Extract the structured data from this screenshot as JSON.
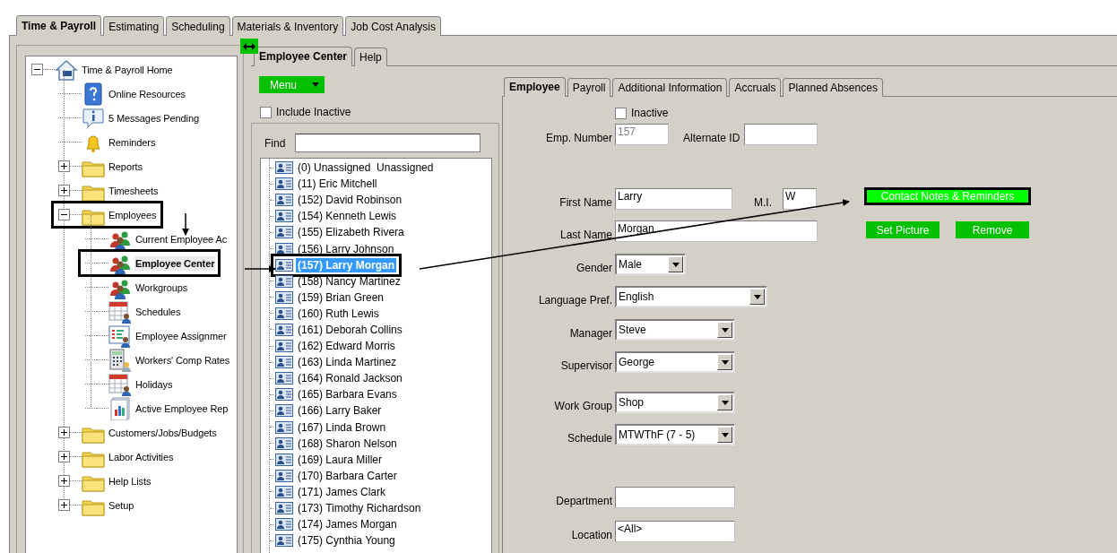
{
  "app_tabs": [
    {
      "label": "Time & Payroll",
      "selected": true
    },
    {
      "label": "Estimating",
      "selected": false
    },
    {
      "label": "Scheduling",
      "selected": false
    },
    {
      "label": "Materials & Inventory",
      "selected": false
    },
    {
      "label": "Job Cost Analysis",
      "selected": false
    }
  ],
  "nav_tree": {
    "label": "Time & Payroll Home",
    "kind": "home",
    "expanded": true,
    "selected": false,
    "highlighted": false,
    "children": [
      {
        "label": "Online Resources",
        "kind": "help",
        "selected": false,
        "highlighted": false
      },
      {
        "label": "5 Messages Pending",
        "kind": "info",
        "selected": false,
        "highlighted": false
      },
      {
        "label": "Reminders",
        "kind": "bell",
        "selected": false,
        "highlighted": false
      },
      {
        "label": "Reports",
        "kind": "folder",
        "expanded": false,
        "selected": false,
        "highlighted": false
      },
      {
        "label": "Timesheets",
        "kind": "folder",
        "expanded": false,
        "selected": false,
        "highlighted": false
      },
      {
        "label": "Employees",
        "kind": "folder",
        "expanded": true,
        "selected": false,
        "highlighted": true,
        "children": [
          {
            "label": "Current Employee Ac",
            "kind": "people",
            "selected": false,
            "highlighted": false
          },
          {
            "label": "Employee Center",
            "kind": "people",
            "selected": true,
            "highlighted": true
          },
          {
            "label": "Workgroups",
            "kind": "people",
            "selected": false,
            "highlighted": false
          },
          {
            "label": "Schedules",
            "kind": "calendar",
            "selected": false,
            "highlighted": false
          },
          {
            "label": "Employee Assignmer",
            "kind": "assignment",
            "selected": false,
            "highlighted": false
          },
          {
            "label": "Workers' Comp Rates",
            "kind": "calculator",
            "selected": false,
            "highlighted": false
          },
          {
            "label": "Holidays",
            "kind": "calendar",
            "selected": false,
            "highlighted": false
          },
          {
            "label": "Active Employee Rep",
            "kind": "report",
            "selected": false,
            "highlighted": false
          }
        ]
      },
      {
        "label": "Customers/Jobs/Budgets",
        "kind": "folder",
        "expanded": false,
        "selected": false,
        "highlighted": false
      },
      {
        "label": "Labor Activities",
        "kind": "folder",
        "expanded": false,
        "selected": false,
        "highlighted": false
      },
      {
        "label": "Help Lists",
        "kind": "folder",
        "expanded": false,
        "selected": false,
        "highlighted": false
      },
      {
        "label": "Setup",
        "kind": "folder",
        "expanded": false,
        "selected": false,
        "highlighted": false
      }
    ]
  },
  "center_tabs": [
    {
      "label": "Employee Center",
      "selected": true
    },
    {
      "label": "Help",
      "selected": false
    }
  ],
  "menu_button": {
    "label": "Menu"
  },
  "include_inactive": {
    "label": "Include Inactive",
    "checked": false
  },
  "find": {
    "label": "Find"
  },
  "employees": [
    {
      "label": "(0) Unassigned  Unassigned",
      "selected": false,
      "highlighted": false
    },
    {
      "label": "(11) Eric Mitchell",
      "selected": false,
      "highlighted": false
    },
    {
      "label": "(152) David Robinson",
      "selected": false,
      "highlighted": false
    },
    {
      "label": "(154) Kenneth Lewis",
      "selected": false,
      "highlighted": false
    },
    {
      "label": "(155) Elizabeth Rivera",
      "selected": false,
      "highlighted": false
    },
    {
      "label": "(156) Larry Johnson",
      "selected": false,
      "highlighted": false
    },
    {
      "label": "(157) Larry Morgan",
      "selected": true,
      "highlighted": true
    },
    {
      "label": "(158) Nancy Martinez",
      "selected": false,
      "highlighted": false
    },
    {
      "label": "(159) Brian Green",
      "selected": false,
      "highlighted": false
    },
    {
      "label": "(160) Ruth Lewis",
      "selected": false,
      "highlighted": false
    },
    {
      "label": "(161) Deborah Collins",
      "selected": false,
      "highlighted": false
    },
    {
      "label": "(162) Edward Morris",
      "selected": false,
      "highlighted": false
    },
    {
      "label": "(163) Linda Martinez",
      "selected": false,
      "highlighted": false
    },
    {
      "label": "(164) Ronald Jackson",
      "selected": false,
      "highlighted": false
    },
    {
      "label": "(165) Barbara Evans",
      "selected": false,
      "highlighted": false
    },
    {
      "label": "(166) Larry Baker",
      "selected": false,
      "highlighted": false
    },
    {
      "label": "(167) Linda Brown",
      "selected": false,
      "highlighted": false
    },
    {
      "label": "(168) Sharon Nelson",
      "selected": false,
      "highlighted": false
    },
    {
      "label": "(169) Laura Miller",
      "selected": false,
      "highlighted": false
    },
    {
      "label": "(170) Barbara Carter",
      "selected": false,
      "highlighted": false
    },
    {
      "label": "(171) James Clark",
      "selected": false,
      "highlighted": false
    },
    {
      "label": "(173) Timothy Richardson",
      "selected": false,
      "highlighted": false
    },
    {
      "label": "(174) James Morgan",
      "selected": false,
      "highlighted": false
    },
    {
      "label": "(175) Cynthia Young",
      "selected": false,
      "highlighted": false
    }
  ],
  "detail_tabs": [
    {
      "label": "Employee",
      "selected": true
    },
    {
      "label": "Payroll",
      "selected": false
    },
    {
      "label": "Additional Information",
      "selected": false
    },
    {
      "label": "Accruals",
      "selected": false
    },
    {
      "label": "Planned Absences",
      "selected": false
    }
  ],
  "form_rows": [
    {
      "fields": [
        {
          "kind": "checkbox",
          "label": "Inactive",
          "checked": false
        }
      ]
    },
    {
      "fields": [
        {
          "kind": "text",
          "label": "Emp. Number",
          "value": "157",
          "disabled": true
        },
        {
          "kind": "text",
          "label": "Alternate ID"
        }
      ]
    },
    {
      "fields": [
        {
          "kind": "text",
          "label": "First Name",
          "value": "Larry",
          "disabled": false
        },
        {
          "kind": "text",
          "label": "M.I.",
          "value": "W",
          "disabled": false
        }
      ]
    },
    {
      "fields": [
        {
          "kind": "text",
          "label": "Last Name",
          "value": "Morgan",
          "disabled": false
        }
      ]
    },
    {
      "fields": [
        {
          "kind": "select",
          "label": "Gender",
          "value": "Male"
        }
      ]
    },
    {
      "fields": [
        {
          "kind": "select",
          "label": "Language Pref.",
          "value": "English"
        }
      ]
    },
    {
      "fields": [
        {
          "kind": "select",
          "label": "Manager",
          "value": "Steve"
        }
      ]
    },
    {
      "fields": [
        {
          "kind": "select",
          "label": "Supervisor",
          "value": "George"
        }
      ]
    },
    {
      "fields": [
        {
          "kind": "select",
          "label": "Work Group",
          "value": "Shop"
        }
      ]
    },
    {
      "fields": [
        {
          "kind": "select",
          "label": "Schedule",
          "value": "MTWThF (7 - 5)"
        }
      ]
    },
    {
      "fields": [
        {
          "kind": "text",
          "label": "Department"
        }
      ]
    },
    {
      "fields": [
        {
          "kind": "text",
          "label": "Location",
          "value": "<All>",
          "disabled": false
        }
      ]
    }
  ],
  "contact_button": {
    "label": "Contact Notes & Reminders"
  },
  "picture_buttons": [
    {
      "label": "Set Picture"
    },
    {
      "label": "Remove"
    }
  ]
}
